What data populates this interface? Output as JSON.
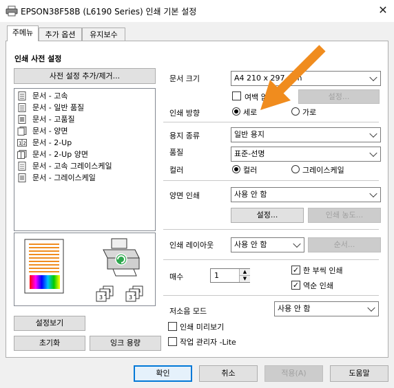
{
  "window": {
    "title": "EPSON38F58B (L6190 Series) 인쇄 기본 설정"
  },
  "tabs": [
    {
      "label": "주메뉴"
    },
    {
      "label": "추가 옵션"
    },
    {
      "label": "유지보수"
    }
  ],
  "presets": {
    "header": "인쇄 사전 설정",
    "add_remove_label": "사전 설정 추가/제거...",
    "items": [
      {
        "label": "문서 - 고속"
      },
      {
        "label": "문서 - 일반 품질"
      },
      {
        "label": "문서 - 고품질"
      },
      {
        "label": "문서 - 양면"
      },
      {
        "label": "문서 - 2-Up"
      },
      {
        "label": "문서 - 2-Up 양면"
      },
      {
        "label": "문서 - 고속 그레이스케일"
      },
      {
        "label": "문서 - 그레이스케일"
      }
    ],
    "preview_label": "설정보기",
    "reset_label": "초기화",
    "ink_label": "잉크 용량"
  },
  "settings": {
    "paper_size": {
      "label": "문서 크기",
      "value": "A4 210 x 297 mm"
    },
    "borderless": {
      "label": "여백 없음",
      "checked": false,
      "settings_label": "설정..."
    },
    "orientation": {
      "label": "인쇄 방향",
      "options": [
        {
          "label": "세로",
          "selected": true
        },
        {
          "label": "가로",
          "selected": false
        }
      ]
    },
    "paper_type": {
      "label": "용지 종류",
      "value": "일반 용지"
    },
    "quality": {
      "label": "품질",
      "value": "표준-선명"
    },
    "color": {
      "label": "컬러",
      "options": [
        {
          "label": "컬러",
          "selected": true
        },
        {
          "label": "그레이스케일",
          "selected": false
        }
      ]
    },
    "duplex": {
      "label": "양면 인쇄",
      "value": "사용 안 함",
      "settings_label": "설정...",
      "density_label": "인쇄 농도..."
    },
    "layout": {
      "label": "인쇄 레이아웃",
      "value": "사용 안 함",
      "order_label": "순서..."
    },
    "copies": {
      "label": "매수",
      "value": "1",
      "collate": {
        "label": "한 부씩 인쇄",
        "checked": true
      },
      "reverse": {
        "label": "역순 인쇄",
        "checked": true
      }
    },
    "quiet_mode": {
      "label": "저소음 모드",
      "value": "사용 안 함"
    },
    "print_preview": {
      "label": "인쇄 미리보기",
      "checked": false
    },
    "job_arranger": {
      "label": "작업 관리자 -Lite",
      "checked": false
    }
  },
  "footer": {
    "ok": "확인",
    "cancel": "취소",
    "apply": "적용(A)",
    "help": "도움말"
  },
  "colors": {
    "accent": "#0078d7",
    "arrow": "#f08c1e"
  }
}
